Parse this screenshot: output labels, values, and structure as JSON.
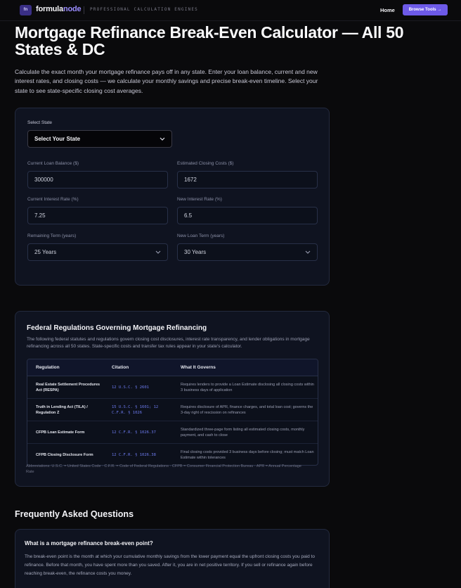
{
  "nav": {
    "logo_mark": "fn",
    "brand_part1": "formula",
    "brand_part2": "node",
    "tagline": "PROFESSIONAL CALCULATION ENGINES",
    "home": "Home",
    "browse": "Browse Tools →",
    "accent": "#6d5ae8"
  },
  "hero": {
    "title": "Mortgage Refinance Break-Even Calculator — All 50 States & DC",
    "intro": "Calculate the exact month your mortgage refinance pays off in any state. Enter your loan balance, current and new interest rates, and closing costs — we calculate your monthly savings and precise break-even timeline. Select your state to see state-specific closing cost averages."
  },
  "calculator": {
    "state_label": "Select State",
    "state_value": "Select Your State",
    "fields": {
      "loan_balance_label": "Current Loan Balance ($)",
      "loan_balance_value": "300000",
      "closing_costs_label": "Estimated Closing Costs ($)",
      "closing_costs_value": "1672",
      "current_rate_label": "Current Interest Rate (%)",
      "current_rate_value": "7.25",
      "new_rate_label": "New Interest Rate (%)",
      "new_rate_value": "6.5",
      "remaining_term_label": "Remaining Term (years)",
      "remaining_term_value": "25 Years",
      "new_term_label": "New Loan Term (years)",
      "new_term_value": "30 Years"
    }
  },
  "regulations": {
    "title": "Federal Regulations Governing Mortgage Refinancing",
    "description": "The following federal statutes and regulations govern closing cost disclosures, interest rate transparency, and lender obligations in mortgage refinancing across all 50 states. State-specific costs and transfer tax rules appear in your state's calculator.",
    "headers": [
      "Regulation",
      "Citation",
      "What It Governs"
    ],
    "rows": [
      {
        "regulation": "Real Estate Settlement Procedures Act (RESPA)",
        "citation": "12 U.S.C. § 2601",
        "governs": "Requires lenders to provide a Loan Estimate disclosing all closing costs within 3 business days of application"
      },
      {
        "regulation": "Truth in Lending Act (TILA) / Regulation Z",
        "citation": "15 U.S.C. § 1601; 12 C.F.R. § 1026",
        "governs": "Requires disclosure of APR, finance charges, and total loan cost; governs the 3-day right of rescission on refinances"
      },
      {
        "regulation": "CFPB Loan Estimate Form",
        "citation": "12 C.F.R. § 1026.37",
        "governs": "Standardized three-page form listing all estimated closing costs, monthly payment, and cash to close"
      },
      {
        "regulation": "CFPB Closing Disclosure Form",
        "citation": "12 C.F.R. § 1026.38",
        "governs": "Final closing costs provided 3 business days before closing; must match Loan Estimate within tolerances"
      }
    ],
    "abbreviations": "Abbreviations: U.S.C. = United States Code · C.F.R. = Code of Federal Regulations · CFPB = Consumer Financial Protection Bureau · APR = Annual Percentage Rate"
  },
  "faq": {
    "title": "Frequently Asked Questions",
    "items": [
      {
        "question": "What is a mortgage refinance break-even point?",
        "answer": "The break-even point is the month at which your cumulative monthly savings from the lower payment equal the upfront closing costs you paid to refinance. Before that month, you have spent more than you saved. After it, you are in net positive territory. If you sell or refinance again before reaching break-even, the refinance costs you money."
      }
    ]
  }
}
